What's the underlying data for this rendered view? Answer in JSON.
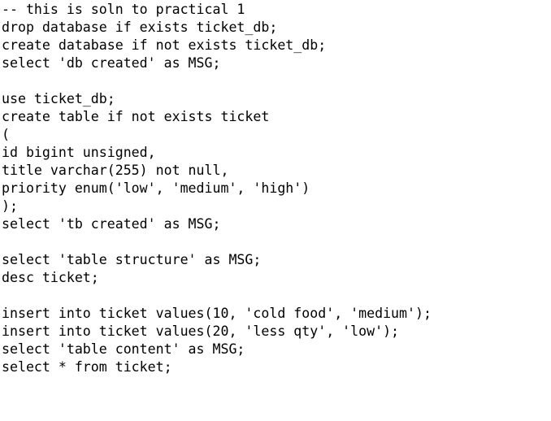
{
  "editor": {
    "lines": [
      "-- this is soln to practical 1",
      "drop database if exists ticket_db;",
      "create database if not exists ticket_db;",
      "select 'db created' as MSG;",
      "",
      "use ticket_db;",
      "create table if not exists ticket",
      "(",
      "id bigint unsigned,",
      "title varchar(255) not null,",
      "priority enum('low', 'medium', 'high')",
      ");",
      "select 'tb created' as MSG;",
      "",
      "select 'table structure' as MSG;",
      "desc ticket;",
      "",
      "insert into ticket values(10, 'cold food', 'medium');",
      "insert into ticket values(20, 'less qty', 'low');",
      "select 'table content' as MSG;",
      "select * from ticket;"
    ]
  }
}
